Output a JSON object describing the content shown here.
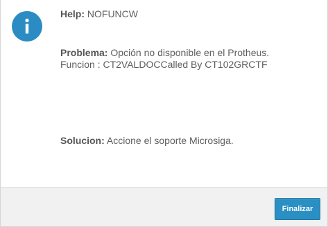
{
  "help": {
    "label": "Help:",
    "value": "NOFUNCW"
  },
  "problema": {
    "label": "Problema:",
    "line1": "Opción no disponible en el Protheus.",
    "line2": "Funcion : CT2VALDOCCalled By CT102GRCTF"
  },
  "solucion": {
    "label": "Solucion:",
    "value": "Accione el soporte Microsiga."
  },
  "footer": {
    "button_label": "Finalizar"
  },
  "icon": {
    "name": "info-icon",
    "color": "#2b8cc4"
  }
}
